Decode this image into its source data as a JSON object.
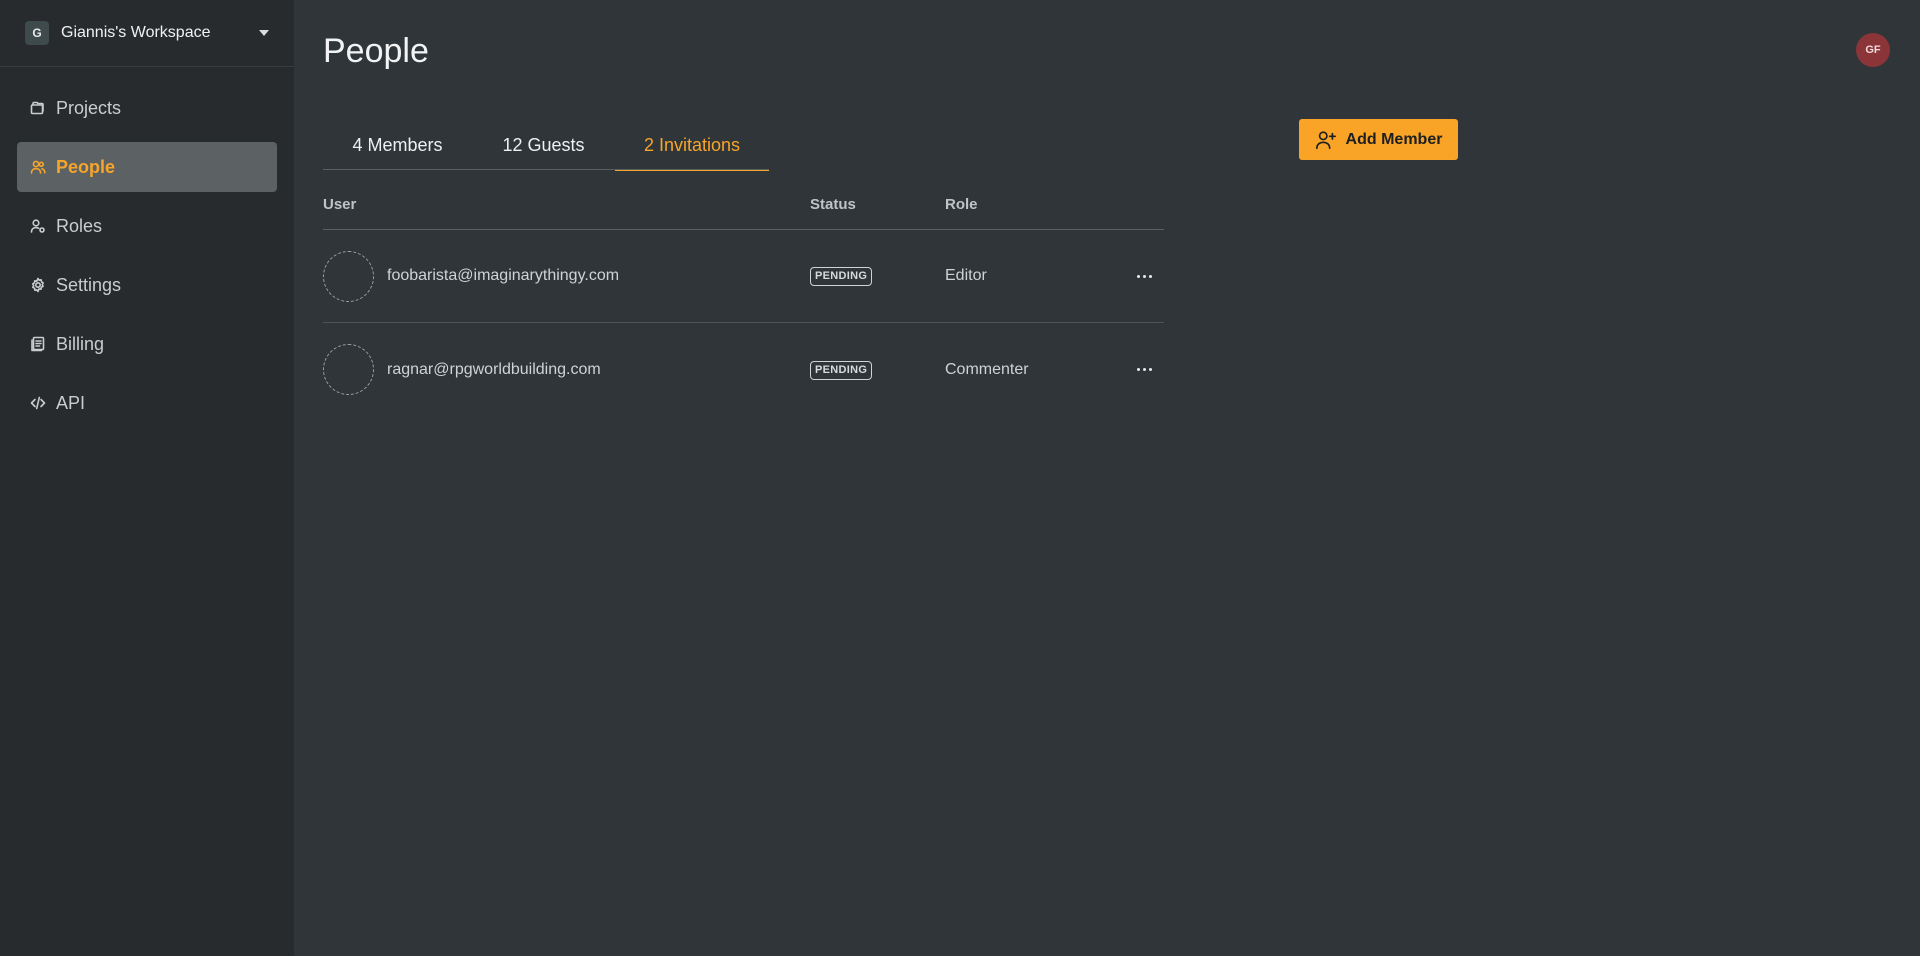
{
  "workspace": {
    "initial": "G",
    "name": "Giannis's Workspace"
  },
  "sidebar": {
    "items": [
      {
        "label": "Projects",
        "icon": "folders-icon"
      },
      {
        "label": "People",
        "icon": "people-icon",
        "active": true
      },
      {
        "label": "Roles",
        "icon": "user-role-icon"
      },
      {
        "label": "Settings",
        "icon": "gear-icon"
      },
      {
        "label": "Billing",
        "icon": "receipt-icon"
      },
      {
        "label": "API",
        "icon": "code-icon"
      }
    ]
  },
  "header": {
    "title": "People",
    "user_initials": "GF"
  },
  "tabs": [
    {
      "label": "4 Members"
    },
    {
      "label": "12 Guests"
    },
    {
      "label": "2 Invitations",
      "active": true
    }
  ],
  "toolbar": {
    "add_member_label": "Add Member"
  },
  "table": {
    "columns": {
      "user": "User",
      "status": "Status",
      "role": "Role"
    },
    "rows": [
      {
        "email": "foobarista@imaginarythingy.com",
        "status": "PENDING",
        "role": "Editor"
      },
      {
        "email": "ragnar@rpgworldbuilding.com",
        "status": "PENDING",
        "role": "Commenter"
      }
    ]
  },
  "colors": {
    "accent": "#f9a426",
    "background": "#2f3538",
    "sidebar": "#272b2d",
    "avatar": "#8b3538"
  }
}
